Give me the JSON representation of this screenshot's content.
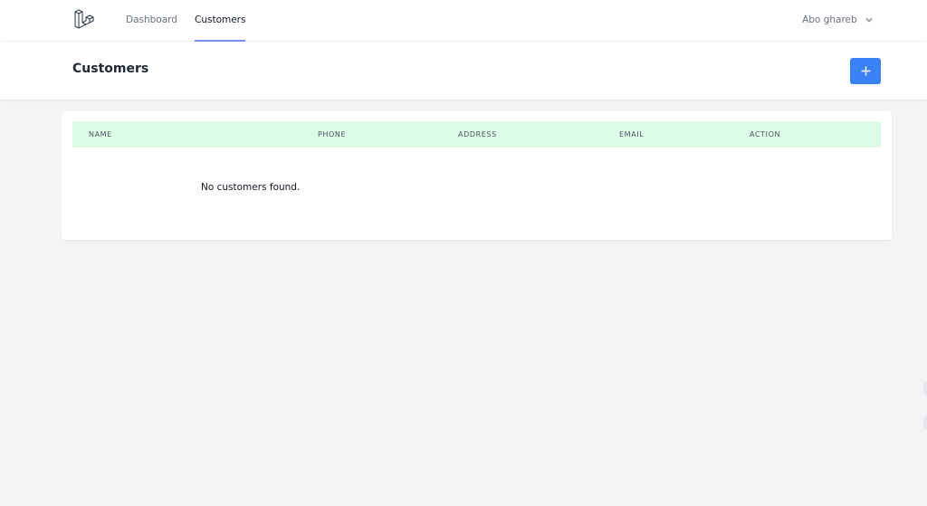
{
  "nav": {
    "links": [
      {
        "label": "Dashboard"
      },
      {
        "label": "Customers"
      }
    ],
    "user_name": "Abo ghareb"
  },
  "header": {
    "title": "Customers",
    "add_button_icon": "plus-icon"
  },
  "table": {
    "columns": [
      "NAME",
      "PHONE",
      "ADDRESS",
      "EMAIL",
      "ACTION"
    ],
    "empty_message": "No customers found."
  },
  "colors": {
    "accent": "#818cf8",
    "primary_button": "#3b82f6",
    "table_header_bg": "#dcfce7"
  }
}
